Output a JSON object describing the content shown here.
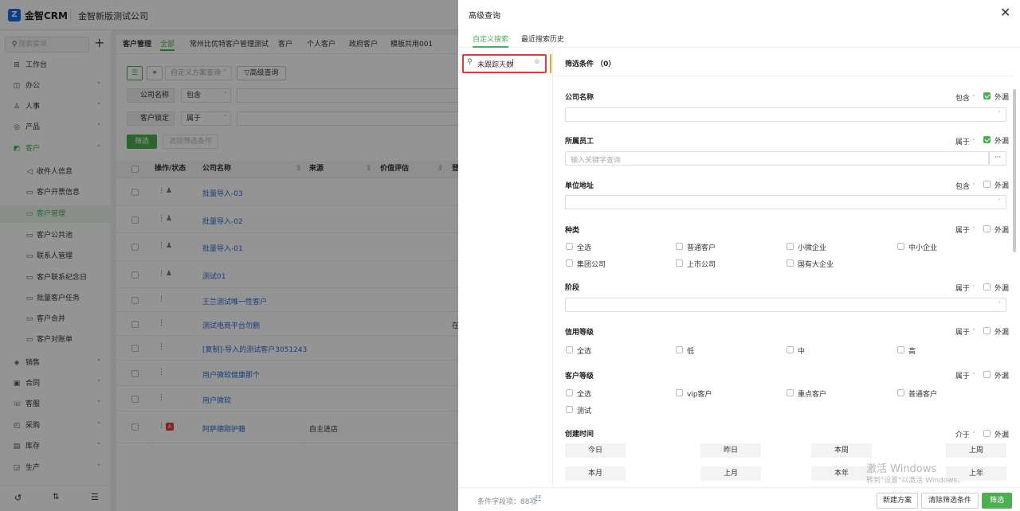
{
  "app": {
    "name": "金智CRM",
    "company": "金智新版测试公司",
    "logo": "Z"
  },
  "sidebar": {
    "search_placeholder": "搜索菜单",
    "items": [
      {
        "label": "工作台",
        "icon": "⊞"
      },
      {
        "label": "办公",
        "icon": "◫"
      },
      {
        "label": "人事",
        "icon": "♙"
      },
      {
        "label": "产品",
        "icon": "◎"
      },
      {
        "label": "客户",
        "icon": "◩"
      }
    ],
    "sub_items": [
      {
        "label": "收件人信息"
      },
      {
        "label": "客户开票信息"
      },
      {
        "label": "客户管理"
      },
      {
        "label": "客户公共池"
      },
      {
        "label": "联系人管理"
      },
      {
        "label": "客户联系纪念日"
      },
      {
        "label": "批量客户任务"
      },
      {
        "label": "客户合并"
      },
      {
        "label": "客户对账单"
      }
    ],
    "items2": [
      {
        "label": "销售",
        "icon": "◈"
      },
      {
        "label": "合同",
        "icon": "▣"
      },
      {
        "label": "客服",
        "icon": "☏"
      },
      {
        "label": "采购",
        "icon": "◰"
      },
      {
        "label": "库存",
        "icon": "▤"
      },
      {
        "label": "生产",
        "icon": "◲"
      }
    ]
  },
  "main": {
    "tabs": [
      "客户管理",
      "全部",
      "常州比优特客户管理测试",
      "客户",
      "个人客户",
      "政府客户",
      "模板共用001"
    ],
    "scheme_placeholder": "自定义方案查询",
    "adv_btn": "高级查询",
    "f1_label": "公司名称",
    "f1_op": "包含",
    "f2_label": "客户锁定",
    "f2_op": "属于",
    "filter_btn": "筛选",
    "clear_btn": "清除筛选条件",
    "columns": [
      "操作/状态",
      "公司名称",
      "来源",
      "价值评估",
      "登"
    ],
    "rows": [
      {
        "name": "批量导入-03",
        "source": "",
        "extra": ""
      },
      {
        "name": "批量导入-02",
        "source": "",
        "extra": ""
      },
      {
        "name": "批量导入-01",
        "source": "",
        "extra": ""
      },
      {
        "name": "测试01",
        "source": "",
        "extra": ""
      },
      {
        "name": "王兰测试唯一性客户",
        "source": "",
        "extra": ""
      },
      {
        "name": "测试电商平台勿删",
        "source": "",
        "extra": "在"
      },
      {
        "name": "[复制]-导入的测试客户3051243",
        "source": "",
        "extra": ""
      },
      {
        "name": "用户微软健康那个",
        "source": "",
        "extra": ""
      },
      {
        "name": "用户微软",
        "source": "",
        "extra": ""
      },
      {
        "name": "阿萨德刚护籍",
        "source": "自主进店",
        "extra": ""
      }
    ]
  },
  "drawer": {
    "title": "高级查询",
    "tabs": [
      "自定义搜索",
      "最近搜索历史"
    ],
    "search_value": "未跟踪天数",
    "filter_header": "筛选条件 （0）",
    "ext_label": "外漏",
    "groups": {
      "company": {
        "label": "公司名称",
        "op": "包含"
      },
      "staff": {
        "label": "所属员工",
        "op": "属于",
        "placeholder": "输入关键字查询"
      },
      "address": {
        "label": "单位地址",
        "op": "包含"
      },
      "category": {
        "label": "种类",
        "op": "属于",
        "options": [
          "全选",
          "普通客户",
          "小微企业",
          "中小企业",
          "集团公司",
          "上市公司",
          "国有大企业"
        ]
      },
      "stage": {
        "label": "阶段",
        "op": "属于"
      },
      "credit": {
        "label": "信用等级",
        "op": "属于",
        "options": [
          "全选",
          "低",
          "中",
          "高"
        ]
      },
      "level": {
        "label": "客户等级",
        "op": "属于",
        "options": [
          "全选",
          "vip客户",
          "重点客户",
          "普通客户",
          "测试"
        ]
      },
      "created": {
        "label": "创建时间",
        "op": "介于",
        "buttons": [
          "今日",
          "昨日",
          "本周",
          "上周",
          "本月",
          "上月",
          "本年",
          "上年"
        ]
      }
    },
    "footer": {
      "count": "条件字段项：88项",
      "new_scheme": "新建方案",
      "clear": "清除筛选条件",
      "filter": "筛选"
    }
  },
  "watermark": {
    "line1": "激活 Windows",
    "line2": "转到\"设置\"以激活 Windows。"
  }
}
